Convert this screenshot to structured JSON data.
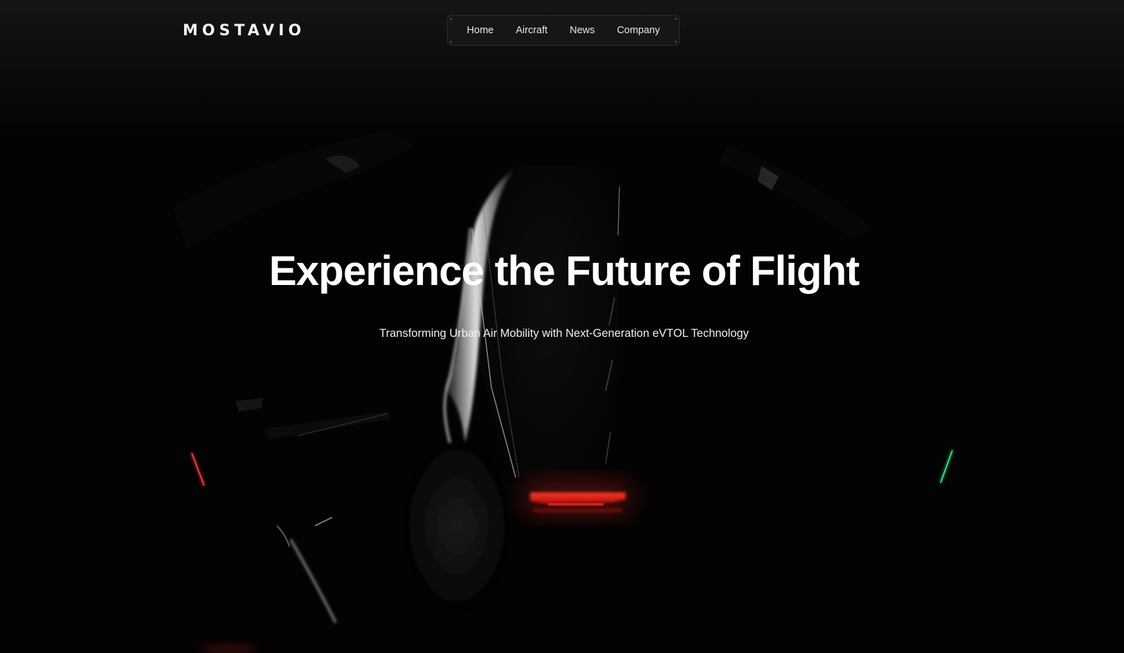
{
  "brand": {
    "logo_text": "MOSTAVIO"
  },
  "nav": {
    "items": [
      {
        "label": "Home"
      },
      {
        "label": "Aircraft"
      },
      {
        "label": "News"
      },
      {
        "label": "Company"
      }
    ]
  },
  "hero": {
    "title": "Experience the Future of Flight",
    "subtitle": "Transforming Urban Air Mobility with Next-Generation eVTOL Technology",
    "image_subject": "eVTOL aircraft silhouette in darkness"
  },
  "colors": {
    "background": "#000000",
    "text": "#ffffff",
    "nav_pill_bg": "#161616",
    "nav_pill_border": "#2c2c2c",
    "tail_light": "#e01818",
    "nav_light_port": "#e52222",
    "nav_light_starboard": "#22d36a"
  }
}
